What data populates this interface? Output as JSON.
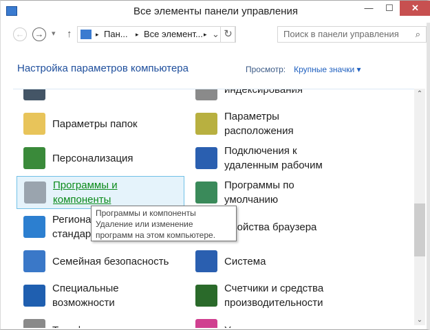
{
  "window": {
    "title": "Все элементы панели управления",
    "minimize": "—",
    "maximize": "☐",
    "close": "✕"
  },
  "nav": {
    "back": "←",
    "forward": "→",
    "recent": "▾",
    "up": "↑",
    "breadcrumb": [
      "Пан...",
      "Все элемент..."
    ],
    "sep": "▸",
    "dropdown": "⌄",
    "refresh": "↻",
    "search_placeholder": "Поиск в панели управления",
    "search_icon": "⌕"
  },
  "header": {
    "title": "Настройка параметров компьютера",
    "view_label": "Просмотр:",
    "view_value": "Крупные значки ▾"
  },
  "items_left": [
    {
      "label": "",
      "icon": "partial-icon",
      "color": "#445566"
    },
    {
      "label": "Параметры папок",
      "icon": "folder-icon",
      "color": "#e8c45a"
    },
    {
      "label": "Персонализация",
      "icon": "personalization-icon",
      "color": "#3a8a3a"
    },
    {
      "label": "Программы и компоненты",
      "icon": "programs-icon",
      "color": "#9aa4ae"
    },
    {
      "label": "Региональные стандарты",
      "icon": "globe-clock-icon",
      "color": "#2c7fd0"
    },
    {
      "label": "Семейная безопасность",
      "icon": "family-icon",
      "color": "#3a78c8"
    },
    {
      "label": "Специальные возможности",
      "icon": "accessibility-icon",
      "color": "#1f5fb0"
    },
    {
      "label": "Телефон и модем",
      "icon": "phone-icon",
      "color": "#8a8a8a"
    }
  ],
  "items_right": [
    {
      "label": "индексирования",
      "icon": "indexing-icon",
      "color": "#8a8a8a"
    },
    {
      "label": "Параметры расположения",
      "icon": "location-icon",
      "color": "#b8b040"
    },
    {
      "label": "Подключения к удаленным рабочим",
      "icon": "remote-desktop-icon",
      "color": "#2a5fb0"
    },
    {
      "label": "Программы по умолчанию",
      "icon": "default-programs-icon",
      "color": "#3a8a5a"
    },
    {
      "label": "Свойства браузера",
      "icon": "browser-icon",
      "color": "#3a80d0"
    },
    {
      "label": "Система",
      "icon": "system-icon",
      "color": "#2a5fb0"
    },
    {
      "label": "Счетчики и средства производительности",
      "icon": "performance-icon",
      "color": "#2a6a2a"
    },
    {
      "label": "Управление цветом",
      "icon": "color-icon",
      "color": "#d04090"
    }
  ],
  "tooltip": {
    "title": "Программы и компоненты",
    "desc": "Удаление или изменение программ на этом компьютере."
  },
  "scrollbar": {
    "up": "⌃",
    "down": "⌄",
    "position_fraction": 0.6
  }
}
